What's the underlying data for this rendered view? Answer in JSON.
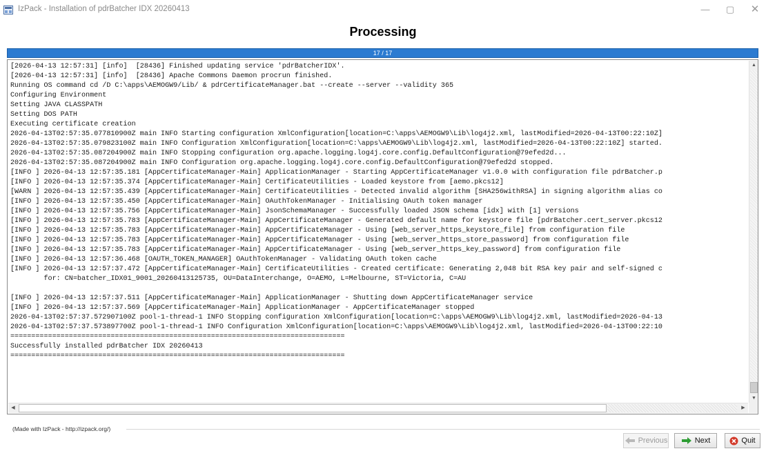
{
  "window": {
    "title": "IzPack - Installation of pdrBatcher IDX 20260413",
    "icon": "installer-app-icon",
    "min_glyph": "—",
    "max_glyph": "▢",
    "close_glyph": "✕"
  },
  "header": {
    "title": "Processing"
  },
  "progress": {
    "label": "17 / 17",
    "current": 17,
    "total": 17,
    "color": "#2c7bd1"
  },
  "log": {
    "lines": [
      "[2026-04-13 12:57:31] [info]  [28436] Finished updating service 'pdrBatcherIDX'.",
      "[2026-04-13 12:57:31] [info]  [28436] Apache Commons Daemon procrun finished.",
      "Running OS command cd /D C:\\apps\\AEMOGW9/Lib/ & pdrCertificateManager.bat --create --server --validity 365",
      "Configuring Environment",
      "Setting JAVA CLASSPATH",
      "Setting DOS PATH",
      "Executing certificate creation",
      "2026-04-13T02:57:35.077810900Z main INFO Starting configuration XmlConfiguration[location=C:\\apps\\AEMOGW9\\Lib\\log4j2.xml, lastModified=2026-04-13T00:22:10Z]",
      "2026-04-13T02:57:35.079823100Z main INFO Configuration XmlConfiguration[location=C:\\apps\\AEMOGW9\\Lib\\log4j2.xml, lastModified=2026-04-13T00:22:10Z] started.",
      "2026-04-13T02:57:35.087204900Z main INFO Stopping configuration org.apache.logging.log4j.core.config.DefaultConfiguration@79efed2d...",
      "2026-04-13T02:57:35.087204900Z main INFO Configuration org.apache.logging.log4j.core.config.DefaultConfiguration@79efed2d stopped.",
      "[INFO ] 2026-04-13 12:57:35.181 [AppCertificateManager-Main] ApplicationManager - Starting AppCertificateManager v1.0.0 with configuration file pdrBatcher.p",
      "[INFO ] 2026-04-13 12:57:35.374 [AppCertificateManager-Main] CertificateUtilities - Loaded keystore from [aemo.pkcs12]",
      "[WARN ] 2026-04-13 12:57:35.439 [AppCertificateManager-Main] CertificateUtilities - Detected invalid algorithm [SHA256withRSA] in signing algorithm alias co",
      "[INFO ] 2026-04-13 12:57:35.450 [AppCertificateManager-Main] OAuthTokenManager - Initialising OAuth token manager",
      "[INFO ] 2026-04-13 12:57:35.756 [AppCertificateManager-Main] JsonSchemaManager - Successfully loaded JSON schema [idx] with [1] versions",
      "[INFO ] 2026-04-13 12:57:35.783 [AppCertificateManager-Main] AppCertificateManager - Generated default name for keystore file [pdrBatcher.cert_server.pkcs12",
      "[INFO ] 2026-04-13 12:57:35.783 [AppCertificateManager-Main] AppCertificateManager - Using [web_server_https_keystore_file] from configuration file",
      "[INFO ] 2026-04-13 12:57:35.783 [AppCertificateManager-Main] AppCertificateManager - Using [web_server_https_store_password] from configuration file",
      "[INFO ] 2026-04-13 12:57:35.783 [AppCertificateManager-Main] AppCertificateManager - Using [web_server_https_key_password] from configuration file",
      "[INFO ] 2026-04-13 12:57:36.468 [OAUTH_TOKEN_MANAGER] OAuthTokenManager - Validating OAuth token cache",
      "[INFO ] 2026-04-13 12:57:37.472 [AppCertificateManager-Main] CertificateUtilities - Created certificate: Generating 2,048 bit RSA key pair and self-signed c",
      "        for: CN=batcher_IDX01_9001_20260413125735, OU=DataInterchange, O=AEMO, L=Melbourne, ST=Victoria, C=AU",
      "",
      "[INFO ] 2026-04-13 12:57:37.511 [AppCertificateManager-Main] ApplicationManager - Shutting down AppCertificateManager service",
      "[INFO ] 2026-04-13 12:57:37.569 [AppCertificateManager-Main] ApplicationManager - AppCertificateManager stopped",
      "2026-04-13T02:57:37.572907100Z pool-1-thread-1 INFO Stopping configuration XmlConfiguration[location=C:\\apps\\AEMOGW9\\Lib\\log4j2.xml, lastModified=2026-04-13",
      "2026-04-13T02:57:37.573897700Z pool-1-thread-1 INFO Configuration XmlConfiguration[location=C:\\apps\\AEMOGW9\\Lib\\log4j2.xml, lastModified=2026-04-13T00:22:10",
      "================================================================================",
      "Successfully installed pdrBatcher IDX 20260413",
      "================================================================================"
    ]
  },
  "scrollbars": {
    "up": "▲",
    "down": "▼",
    "left": "◀",
    "right": "▶"
  },
  "footer": {
    "made_with": "(Made with IzPack - http://izpack.org/)",
    "previous_label": "Previous",
    "next_label": "Next",
    "quit_label": "Quit",
    "next_icon_color": "#2e9d34",
    "quit_icon_color": "#d23a2a"
  }
}
